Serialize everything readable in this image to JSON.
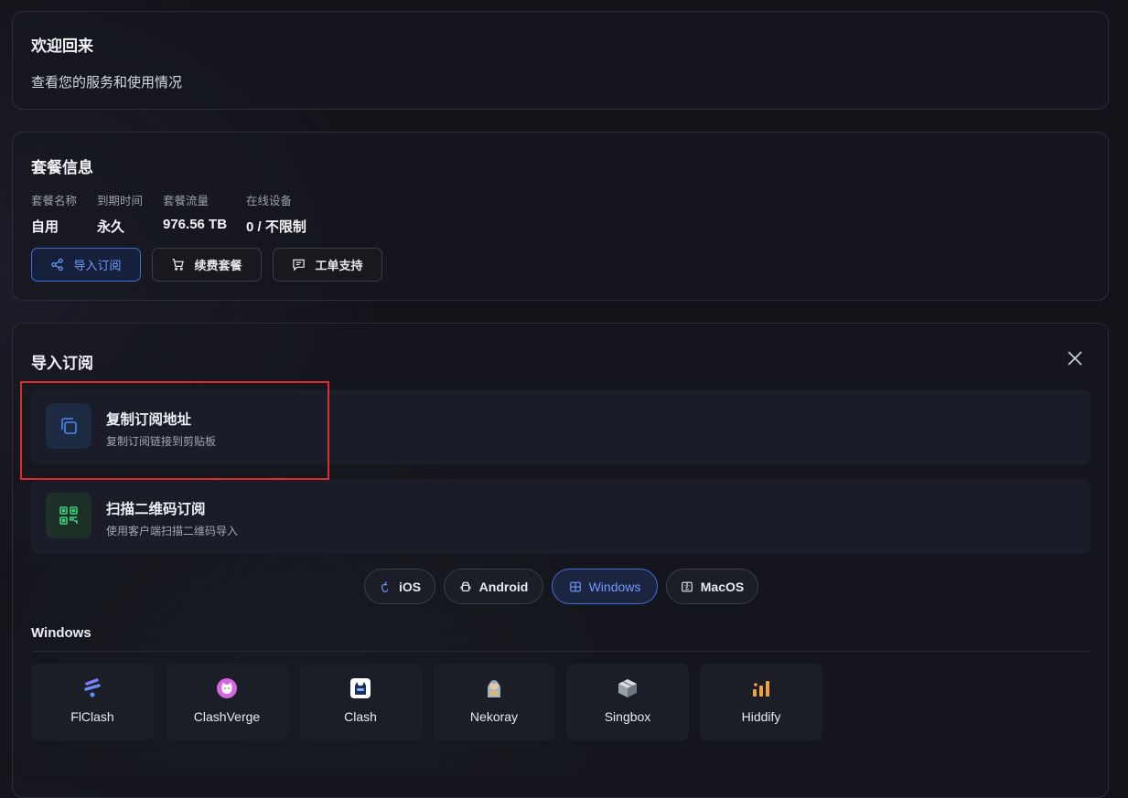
{
  "welcome": {
    "title": "欢迎回来",
    "subtitle": "查看您的服务和使用情况"
  },
  "plan": {
    "title": "套餐信息",
    "stats": [
      {
        "label": "套餐名称",
        "value": "自用"
      },
      {
        "label": "到期时间",
        "value": "永久"
      },
      {
        "label": "套餐流量",
        "value": "976.56 TB"
      },
      {
        "label": "在线设备",
        "value": "0 / 不限制"
      }
    ],
    "buttons": {
      "import": "导入订阅",
      "renew": "续费套餐",
      "ticket": "工单支持"
    }
  },
  "import_panel": {
    "title": "导入订阅",
    "options": [
      {
        "title": "复制订阅地址",
        "desc": "复制订阅链接到剪贴板",
        "icon": "copy-icon"
      },
      {
        "title": "扫描二维码订阅",
        "desc": "使用客户端扫描二维码导入",
        "icon": "qr-code-icon"
      }
    ],
    "platforms": [
      {
        "label": "iOS",
        "icon": "apple-icon"
      },
      {
        "label": "Android",
        "icon": "android-icon"
      },
      {
        "label": "Windows",
        "icon": "windows-icon",
        "active": true
      },
      {
        "label": "MacOS",
        "icon": "macos-icon"
      }
    ],
    "section_label": "Windows",
    "apps": [
      {
        "name": "FlClash",
        "icon": "flclash-icon"
      },
      {
        "name": "ClashVerge",
        "icon": "clashverge-icon"
      },
      {
        "name": "Clash",
        "icon": "clash-icon"
      },
      {
        "name": "Nekoray",
        "icon": "nekoray-icon"
      },
      {
        "name": "Singbox",
        "icon": "singbox-icon"
      },
      {
        "name": "Hiddify",
        "icon": "hiddify-icon"
      }
    ]
  },
  "colors": {
    "accent": "#3f6fd8",
    "highlight_box": "#e02b2b",
    "background": "#13141a"
  }
}
